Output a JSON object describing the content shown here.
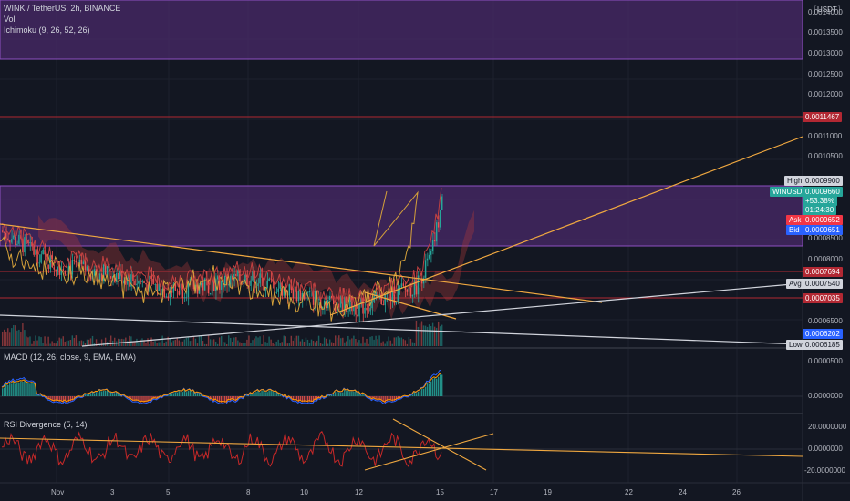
{
  "header": {
    "symbol_line": "WINK / TetherUS, 2h, BINANCE",
    "vol_label": "Vol",
    "ichimoku_label": "Ichimoku (9, 26, 52, 26)",
    "currency_button": "USDT"
  },
  "macd_panel": {
    "label": "MACD (12, 26, close, 9, EMA, EMA)"
  },
  "rsi_panel": {
    "label": "RSI Divergence (5, 14)"
  },
  "price_scale": {
    "ticks": [
      "0.0014000",
      "0.0013500",
      "0.0013000",
      "0.0012500",
      "0.0012000",
      "0.0011000",
      "0.0010500",
      "0.0008500",
      "0.0008000",
      "0.0006500"
    ],
    "tags": [
      {
        "label": "",
        "value": "0.0011467",
        "color": "#b22833"
      },
      {
        "label": "High",
        "value": "0.0009900",
        "color": "#d1d4dc"
      },
      {
        "label": "WINUSDT",
        "value": "0.0009660",
        "color": "#26a69a"
      },
      {
        "label": "",
        "value": "+53.38%",
        "color": "#26a69a"
      },
      {
        "label": "",
        "value": "01:24:30",
        "color": "#26a69a"
      },
      {
        "label": "Ask",
        "value": "0.0009652",
        "color": "#f23645"
      },
      {
        "label": "Bid",
        "value": "0.0009651",
        "color": "#2962ff"
      },
      {
        "label": "",
        "value": "0.0007694",
        "color": "#b22833"
      },
      {
        "label": "Avg",
        "value": "0.0007540",
        "color": "#d1d4dc"
      },
      {
        "label": "",
        "value": "0.0007035",
        "color": "#b22833"
      },
      {
        "label": "",
        "value": "0.0006202",
        "color": "#2962ff"
      },
      {
        "label": "Low",
        "value": "0.0006185",
        "color": "#d1d4dc"
      }
    ]
  },
  "macd_scale": {
    "ticks": [
      "0.0000500",
      "0.0000000"
    ]
  },
  "rsi_scale": {
    "ticks": [
      "20.0000000",
      "0.0000000",
      "-20.0000000"
    ]
  },
  "time_axis": {
    "ticks": [
      "Nov",
      "3",
      "5",
      "8",
      "10",
      "12",
      "15",
      "17",
      "19",
      "22",
      "24",
      "26"
    ]
  },
  "colors": {
    "background": "#131722",
    "zone": "#4a2a6a",
    "zone_border": "#8e4fc1",
    "horizontal_line": "#b22833",
    "trendline": "#f0a840",
    "up": "#26a69a",
    "down": "#ef5350",
    "rsi_up": "#2e7d32",
    "rsi_down": "#c62828"
  },
  "chart_data": {
    "type": "candlestick",
    "symbol": "WINK / TetherUS",
    "interval": "2h",
    "exchange": "BINANCE",
    "price_range": [
      0.00061,
      0.00142
    ],
    "horizontal_levels": [
      0.0011467,
      0.0007694,
      0.0007035
    ],
    "zones": [
      {
        "from": 0.00129,
        "to": 0.00142
      },
      {
        "from": 0.00085,
        "to": 0.00099
      }
    ],
    "price_path": [
      {
        "t": "Oct 30",
        "close": 0.00088
      },
      {
        "t": "Nov 1",
        "close": 0.0008
      },
      {
        "t": "Nov 3",
        "close": 0.00078
      },
      {
        "t": "Nov 5",
        "close": 0.00074
      },
      {
        "t": "Nov 8",
        "close": 0.00077
      },
      {
        "t": "Nov 10",
        "close": 0.00073
      },
      {
        "t": "Nov 12",
        "close": 0.0007
      },
      {
        "t": "Nov 14",
        "close": 0.00075
      },
      {
        "t": "Nov 15",
        "close": 0.000966
      }
    ],
    "last_price": 0.000966,
    "change_percent": 53.38,
    "high": 0.00099,
    "low": 0.0006185,
    "avg": 0.000754,
    "ask": 0.0009652,
    "bid": 0.0009651,
    "macd_range": [
      -1e-05,
      6e-05
    ],
    "rsi_range": [
      -25,
      25
    ]
  }
}
